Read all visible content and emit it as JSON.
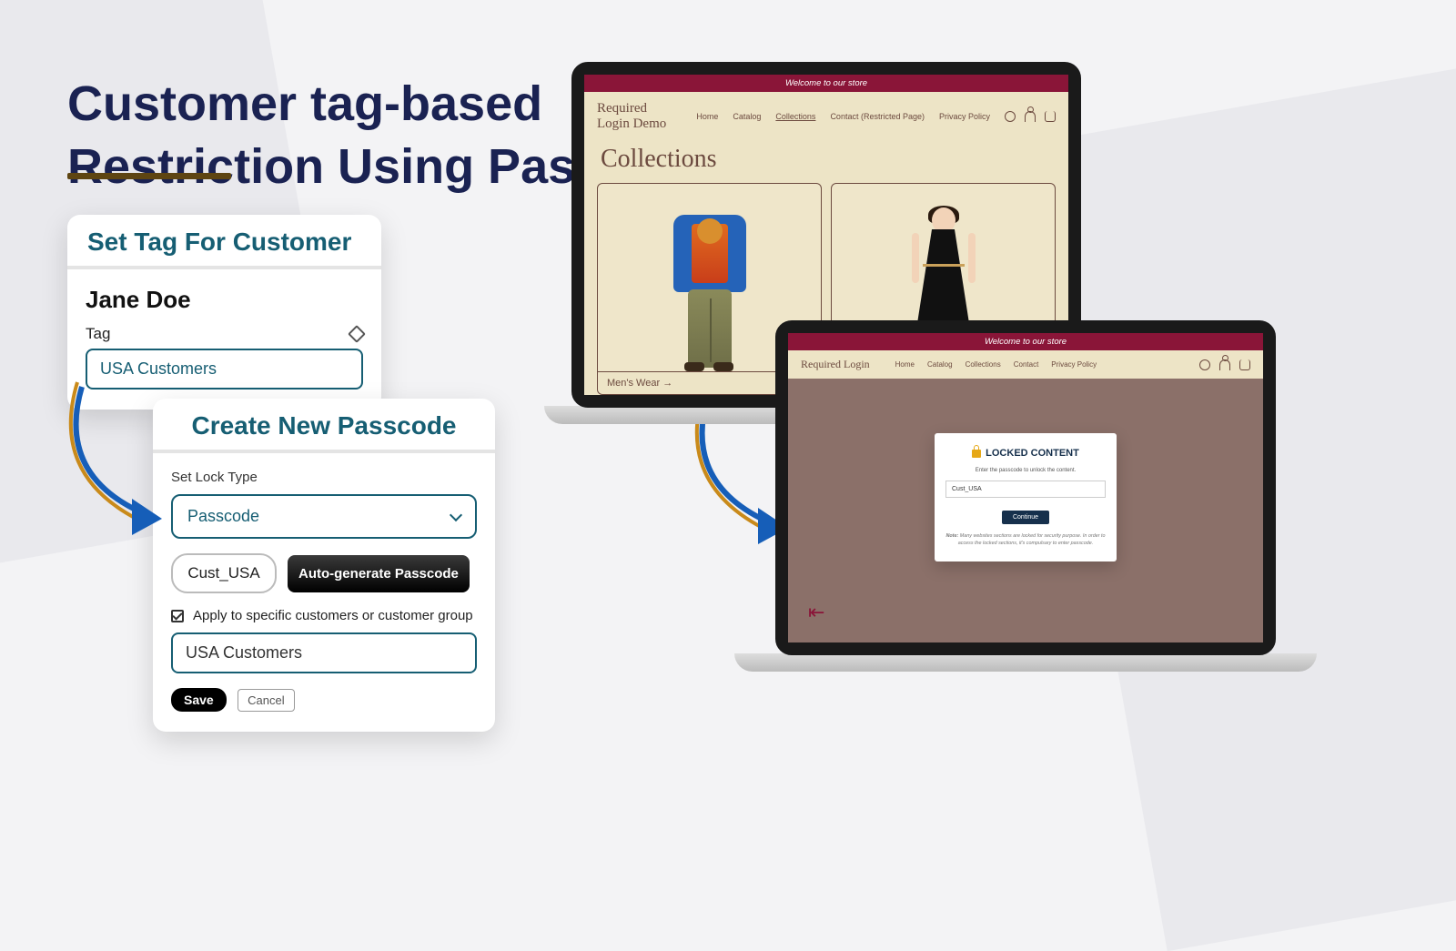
{
  "headline": {
    "line1": "Customer tag-based",
    "line2": "Restriction Using Passcode"
  },
  "card1": {
    "title": "Set Tag For Customer",
    "name": "Jane Doe",
    "tag_label": "Tag",
    "tag_value": "USA Customers"
  },
  "card2": {
    "title": "Create New Passcode",
    "lock_type_label": "Set Lock Type",
    "lock_type_value": "Passcode",
    "passcode_value": "Cust_USA",
    "autogen_label": "Auto-generate Passcode",
    "apply_label": "Apply to specific customers or customer group",
    "apply_value": "USA Customers",
    "save": "Save",
    "cancel": "Cancel"
  },
  "store1": {
    "banner": "Welcome to our store",
    "brand": "Required Login Demo",
    "nav": {
      "home": "Home",
      "catalog": "Catalog",
      "collections": "Collections",
      "contact": "Contact (Restricted Page)",
      "privacy": "Privacy Policy"
    },
    "page_title": "Collections",
    "mens_label": "Men's Wear →"
  },
  "store2": {
    "banner": "Welcome to our store",
    "brand": "Required Login",
    "nav": {
      "home": "Home",
      "catalog": "Catalog",
      "collections": "Collections",
      "contact": "Contact",
      "privacy": "Privacy Policy"
    },
    "locked_title": "LOCKED CONTENT",
    "locked_sub": "Enter the passcode to unlock the content.",
    "locked_input": "Cust_USA",
    "continue": "Continue",
    "note_prefix": "Note:",
    "note": " Many websites sections are locked for security purpose. In order to access the locked sections, it's compulsary to enter passcode."
  }
}
